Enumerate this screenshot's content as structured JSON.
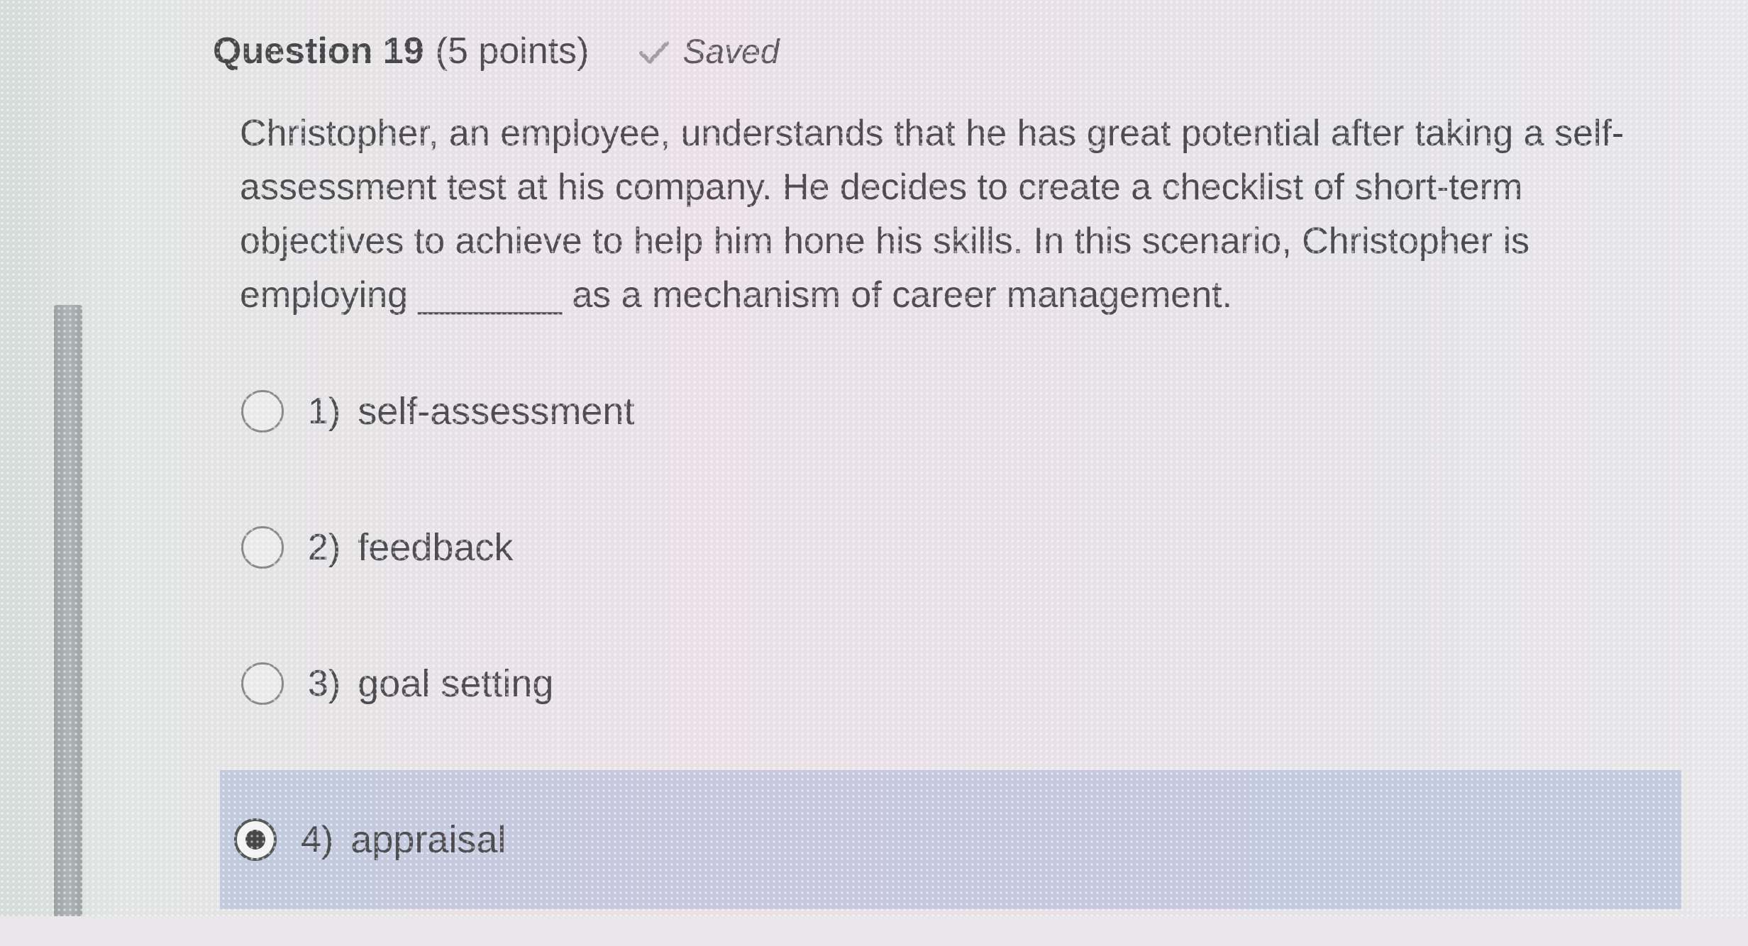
{
  "question": {
    "title": "Question 19",
    "points": "(5 points)",
    "status": "Saved",
    "status_icon": "check-icon",
    "text": "Christopher, an employee, understands that he has great potential after taking a self-assessment test at his company. He decides to create a checklist of short-term objectives to achieve to help him hone his skills. In this scenario, Christopher is employing _______ as a mechanism of career management."
  },
  "options": [
    {
      "number": "1)",
      "label": "self-assessment",
      "selected": false
    },
    {
      "number": "2)",
      "label": "feedback",
      "selected": false
    },
    {
      "number": "3)",
      "label": "goal setting",
      "selected": false
    },
    {
      "number": "4)",
      "label": "appraisal",
      "selected": true
    }
  ],
  "colors": {
    "selected_highlight": "#96aad7",
    "text": "#1d1f24"
  }
}
